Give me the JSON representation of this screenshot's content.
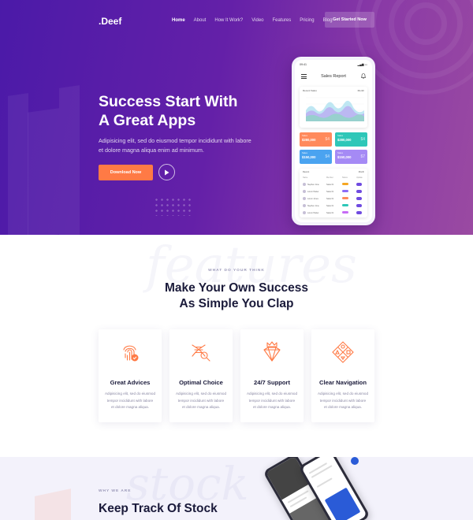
{
  "brand": {
    "name": ".Deef"
  },
  "nav": {
    "items": [
      "Home",
      "About",
      "How It Work?",
      "Video",
      "Features",
      "Pricing",
      "Blog"
    ],
    "active": "Home",
    "cta": "Get Started Now"
  },
  "hero": {
    "title_line1": "Success Start With",
    "title_line2": "A Great Apps",
    "subtitle_line1": "Adipisicing elit, sed do eiusmod tempor incididunt with labore",
    "subtitle_line2": "et dolore magna aliqua enim ad minimum.",
    "download_label": "Download Now",
    "play_icon": "play-icon"
  },
  "phone": {
    "time": "09:41",
    "title": "Sales Report",
    "chart_title": "Recent Sales",
    "chart_period": "Month",
    "stats": [
      {
        "label": "Sales",
        "value": "$280,000",
        "mark": "$4"
      },
      {
        "label": "Sales",
        "value": "$280,000",
        "mark": "$4"
      },
      {
        "label": "Sales",
        "value": "$150,000",
        "mark": "$4"
      },
      {
        "label": "Sales",
        "value": "$150,000",
        "mark": "$7"
      }
    ],
    "stat_colors": [
      "#ff8a5c",
      "#2ec7b8",
      "#4aa3f0",
      "#a58af5"
    ],
    "table_title": "Recent",
    "table_filter": "Month",
    "table_cols": [
      "Name",
      "Member",
      "Status",
      "Update"
    ],
    "rows": [
      {
        "name": "Stephen Jone",
        "member": "Sales 01"
      },
      {
        "name": "Lorem Parker",
        "member": "Sales 01"
      },
      {
        "name": "Lorem Jones",
        "member": "Sales 01"
      },
      {
        "name": "Stephen Jone",
        "member": "Sales 01"
      },
      {
        "name": "Lorem Parker",
        "member": "Sales 01"
      }
    ],
    "pill_colors": [
      "#f5a623",
      "#8c6cf7",
      "#ff8a5c",
      "#2ec7b8",
      "#c66cf5"
    ]
  },
  "features": {
    "eyebrow": "WHAT DO YOUR THINK",
    "title_line1": "Make Your Own Success",
    "title_line2": "As Simple You Clap",
    "watermark": "features",
    "cards": [
      {
        "icon": "fingerprint-icon",
        "title": "Great Advices",
        "desc_line1": "Adipisicing elit, sed do eiusmod",
        "desc_line2": "tempor incididunt with labore",
        "desc_line3": "et dolore magna aliqua."
      },
      {
        "icon": "dna-search-icon",
        "title": "Optimal Choice",
        "desc_line1": "Adipisicing elit, sed do eiusmod",
        "desc_line2": "tempor incididunt with labore",
        "desc_line3": "et dolore magna aliqua."
      },
      {
        "icon": "diamond-crown-icon",
        "title": "24/7 Support",
        "desc_line1": "Adipisicing elit, sed do eiusmod",
        "desc_line2": "tempor incididunt with labore",
        "desc_line3": "et dolore magna aliqua."
      },
      {
        "icon": "navigation-shapes-icon",
        "title": "Clear Navigation",
        "desc_line1": "Adipisicing elit, sed do eiusmod",
        "desc_line2": "tempor incididunt with labore",
        "desc_line3": "et dolore magna aliqua."
      }
    ],
    "accent": "#ff7a45"
  },
  "stock": {
    "eyebrow": "WHY WE ARE",
    "title_line1": "Keep Track Of Stock",
    "watermark": "stock"
  }
}
